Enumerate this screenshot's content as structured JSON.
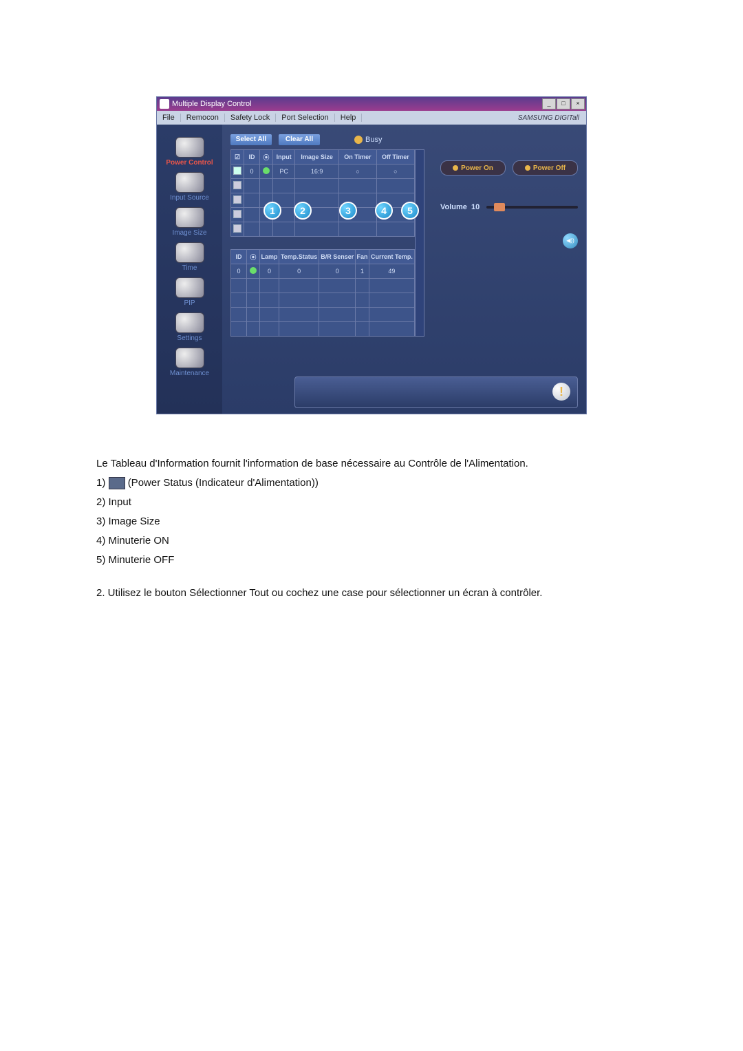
{
  "window": {
    "title": "Multiple Display Control",
    "brand": "SAMSUNG DIGITall"
  },
  "menu": {
    "file": "File",
    "remocon": "Remocon",
    "safety": "Safety Lock",
    "port": "Port Selection",
    "help": "Help"
  },
  "sidebar": {
    "items": [
      {
        "label": "Power Control",
        "active": true
      },
      {
        "label": "Input Source"
      },
      {
        "label": "Image Size"
      },
      {
        "label": "Time"
      },
      {
        "label": "PIP"
      },
      {
        "label": "Settings"
      },
      {
        "label": "Maintenance"
      }
    ]
  },
  "toolbar": {
    "select_all": "Select All",
    "clear_all": "Clear All",
    "busy": "Busy"
  },
  "grid1": {
    "headers": {
      "cb": "☑",
      "id": "ID",
      "status": "⦿",
      "input": "Input",
      "image_size": "Image Size",
      "on_timer": "On Timer",
      "off_timer": "Off Timer"
    },
    "rows": [
      {
        "checked": true,
        "id": "0",
        "status_on": true,
        "input": "PC",
        "image_size": "16:9",
        "on_timer": "○",
        "off_timer": "○"
      },
      {
        "checked": false
      },
      {
        "checked": false
      },
      {
        "checked": false
      },
      {
        "checked": false
      }
    ]
  },
  "grid2": {
    "headers": {
      "id": "ID",
      "status": "⦿",
      "lamp": "Lamp",
      "temp": "Temp.Status",
      "br": "B/R Senser",
      "fan": "Fan",
      "current": "Current Temp."
    },
    "rows": [
      {
        "id": "0",
        "status_on": true,
        "lamp": "0",
        "temp": "0",
        "br": "0",
        "fan": "1",
        "current": "49"
      },
      {},
      {},
      {},
      {}
    ]
  },
  "callouts": [
    "1",
    "2",
    "3",
    "4",
    "5"
  ],
  "power": {
    "on": "Power On",
    "off": "Power Off"
  },
  "volume": {
    "label": "Volume",
    "value": "10"
  },
  "doc": {
    "intro": "Le Tableau d'Information fournit l'information de base nécessaire au Contrôle de l'Alimentation.",
    "items": [
      "(Power Status (Indicateur d'Alimentation))",
      "Input",
      "Image Size",
      "Minuterie ON",
      "Minuterie OFF"
    ],
    "line2": "2.  Utilisez le bouton Sélectionner Tout ou cochez une case pour sélectionner un écran à contrôler."
  }
}
